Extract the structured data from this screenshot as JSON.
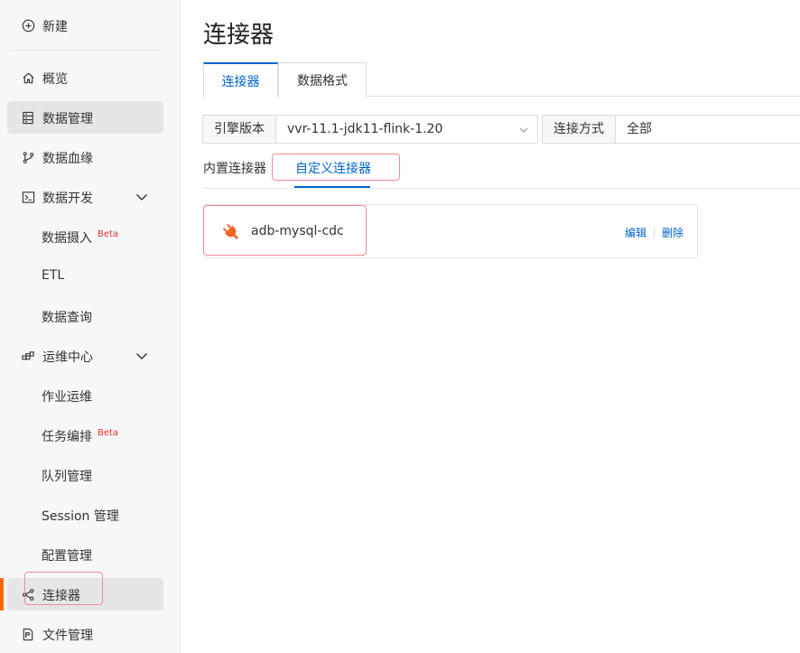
{
  "sidebar": {
    "new_label": "新建",
    "items": [
      {
        "label": "概览"
      },
      {
        "label": "数据管理"
      },
      {
        "label": "数据血缘"
      },
      {
        "label": "数据开发"
      },
      {
        "label": "数据摄入",
        "badge": "Beta"
      },
      {
        "label": "ETL"
      },
      {
        "label": "数据查询"
      },
      {
        "label": "运维中心"
      },
      {
        "label": "作业运维"
      },
      {
        "label": "任务编排",
        "badge": "Beta"
      },
      {
        "label": "队列管理"
      },
      {
        "label": "Session 管理"
      },
      {
        "label": "配置管理"
      },
      {
        "label": "连接器"
      },
      {
        "label": "文件管理"
      }
    ]
  },
  "page": {
    "title": "连接器",
    "tabs": [
      {
        "label": "连接器",
        "active": true
      },
      {
        "label": "数据格式",
        "active": false
      }
    ],
    "filters": {
      "engine_label": "引擎版本",
      "engine_value": "vvr-11.1-jdk11-flink-1.20",
      "connect_label": "连接方式",
      "connect_value": "全部"
    },
    "subtabs": [
      {
        "label": "内置连接器",
        "active": false
      },
      {
        "label": "自定义连接器",
        "active": true
      }
    ],
    "connectors": [
      {
        "name": "adb-mysql-cdc",
        "edit": "编辑",
        "delete": "删除"
      }
    ]
  },
  "colors": {
    "accent": "#0064c8",
    "active_indicator": "#ff6a00",
    "highlight_box": "#f08a93",
    "plug_icon": "#f26522"
  }
}
